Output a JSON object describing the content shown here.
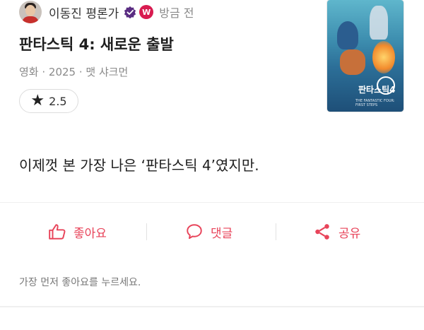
{
  "author": {
    "name": "이동진 평론가",
    "time_ago": "방금 전",
    "badge_letter": "W"
  },
  "movie": {
    "title": "판타스틱 4: 새로운 출발",
    "meta": "영화 · 2025 · 맷 샤크먼",
    "poster": {
      "title": "판타스틱4",
      "caption": "THE FANTASTIC FOUR: FIRST STEPS"
    }
  },
  "rating": {
    "icon": "star-icon",
    "value": "2.5"
  },
  "review": {
    "text": "이제껏 본 가장 나은 ‘판타스틱 4’였지만."
  },
  "actions": {
    "like_label": "좋아요",
    "comment_label": "댓글",
    "share_label": "공유"
  },
  "likes_note": "가장 먼저 좋아요를 누르세요.",
  "colors": {
    "accent": "#e8445a",
    "badge": "#d81b50",
    "muted_text": "#8a8a8a"
  }
}
